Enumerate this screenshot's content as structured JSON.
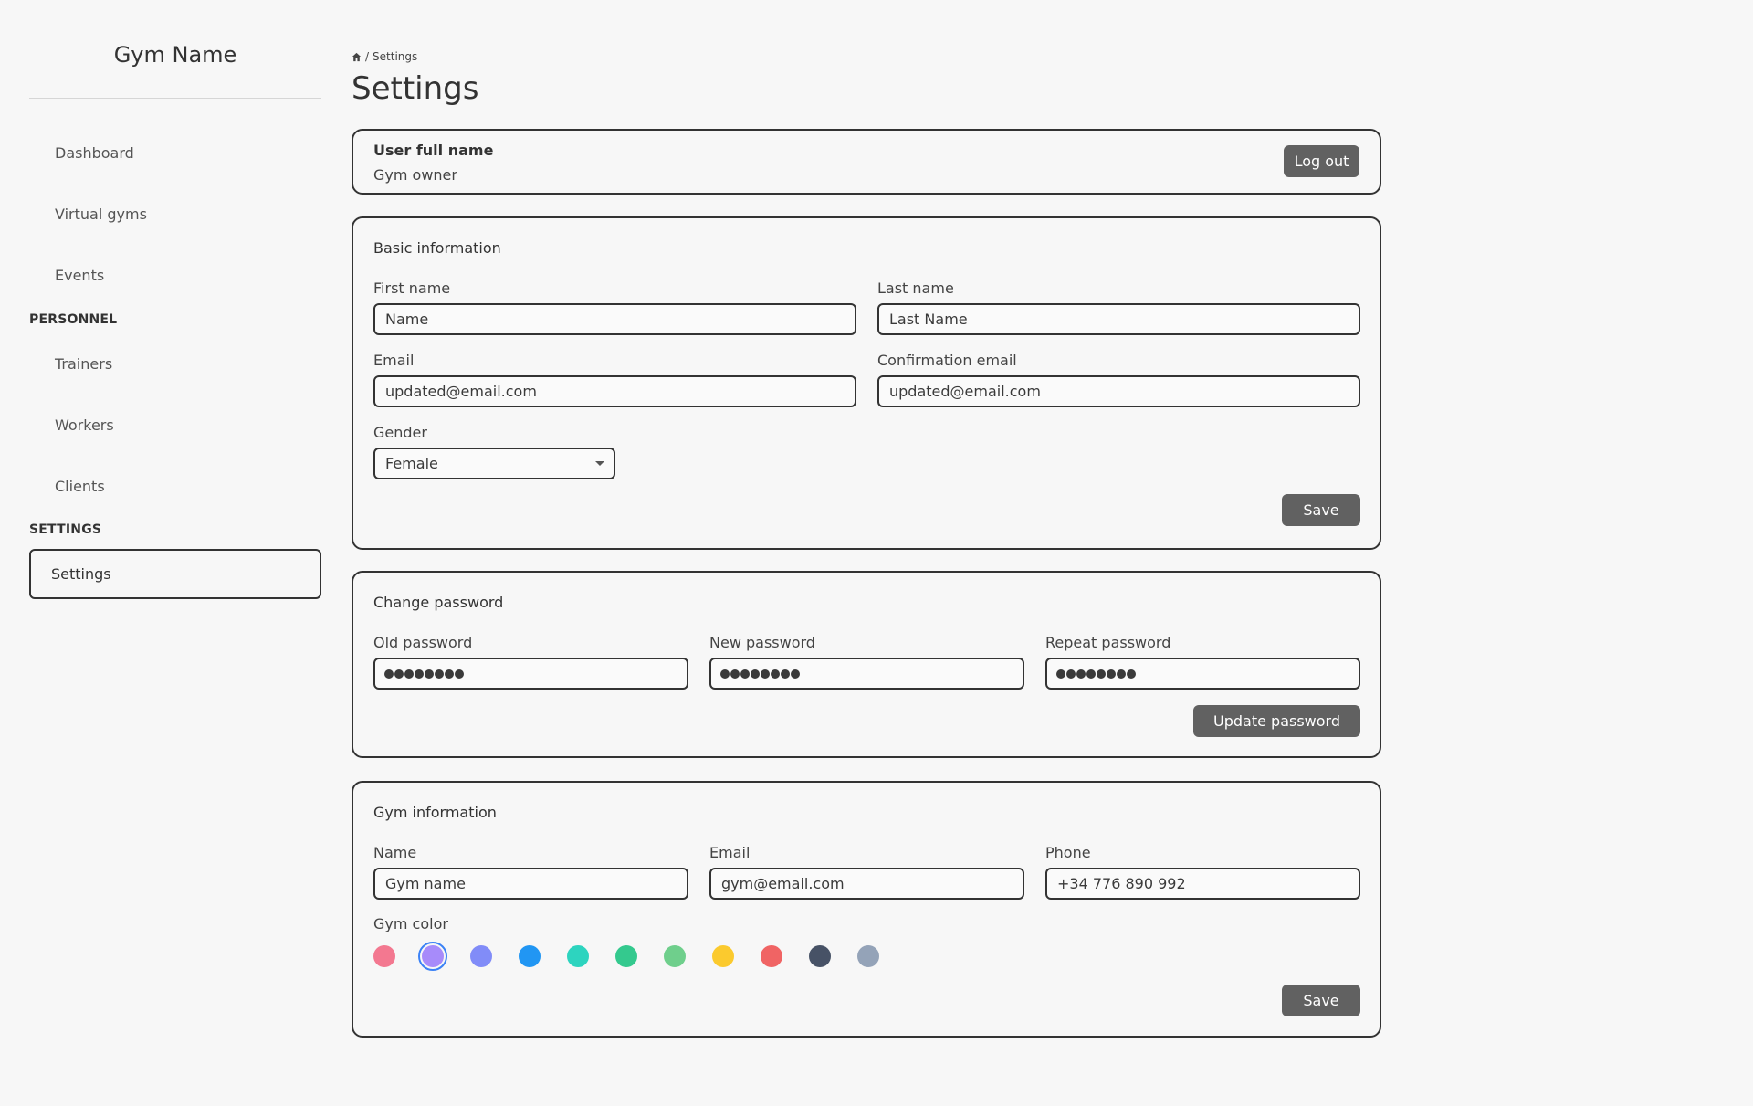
{
  "sidebar": {
    "brand": "Gym Name",
    "items": {
      "dashboard": "Dashboard",
      "virtual_gyms": "Virtual gyms",
      "events": "Events",
      "trainers": "Trainers",
      "workers": "Workers",
      "clients": "Clients",
      "settings": "Settings"
    },
    "headings": {
      "personnel": "PERSONNEL",
      "settings": "SETTINGS"
    }
  },
  "header": {
    "breadcrumb_current": "Settings",
    "breadcrumb_separator": "/",
    "title": "Settings"
  },
  "user_card": {
    "name": "User full name",
    "role": "Gym owner",
    "logout_label": "Log out"
  },
  "basic_info": {
    "title": "Basic information",
    "first_name_label": "First name",
    "first_name_placeholder": "Name",
    "last_name_label": "Last name",
    "last_name_placeholder": "Last Name",
    "email_label": "Email",
    "email_value": "updated@email.com",
    "confirm_email_label": "Confirmation email",
    "confirm_email_value": "updated@email.com",
    "gender_label": "Gender",
    "gender_value": "Female",
    "save_label": "Save"
  },
  "change_password": {
    "title": "Change password",
    "old_label": "Old password",
    "new_label": "New password",
    "repeat_label": "Repeat password",
    "mask_length": 8,
    "update_label": "Update password"
  },
  "gym_info": {
    "title": "Gym information",
    "name_label": "Name",
    "name_placeholder": "Gym name",
    "email_label": "Email",
    "email_placeholder": "gym@email.com",
    "phone_label": "Phone",
    "phone_placeholder": "+34 776 890 992",
    "color_label": "Gym color",
    "colors": [
      "#f37890",
      "#a78bfa",
      "#818cf8",
      "#2196f3",
      "#2dd4bf",
      "#34c98e",
      "#6fcf8c",
      "#fbca2e",
      "#f06464",
      "#475266",
      "#94a3b8"
    ],
    "selected_color_index": 1,
    "save_label": "Save"
  }
}
